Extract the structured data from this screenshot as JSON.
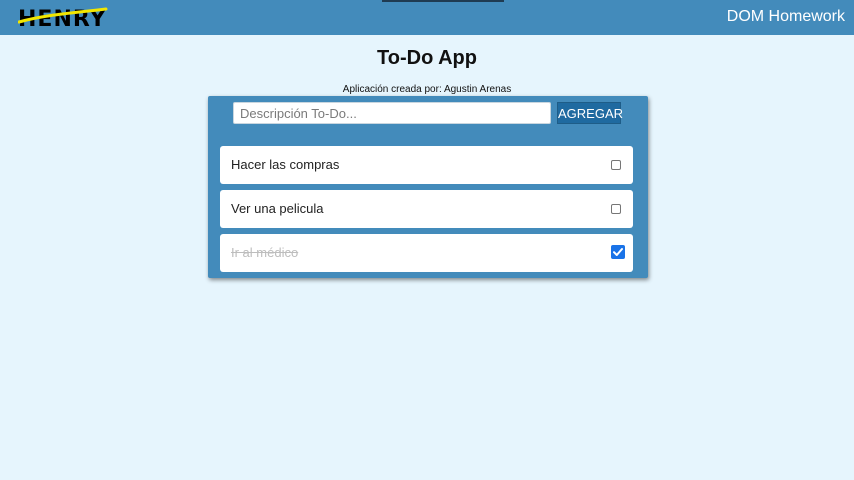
{
  "navbar": {
    "logo_text": "HENRY",
    "title": "DOM Homework"
  },
  "page": {
    "title": "To-Do App",
    "subtitle": "Aplicación creada por: Agustin Arenas"
  },
  "form": {
    "placeholder": "Descripción To-Do...",
    "value": "",
    "add_label": "AGREGAR"
  },
  "todos": [
    {
      "text": "Hacer las compras",
      "completed": false
    },
    {
      "text": "Ver una pelicula",
      "completed": false
    },
    {
      "text": "Ir al médico",
      "completed": true
    }
  ],
  "icons": {
    "logo": "henry-logo-icon",
    "check": "checkmark-icon"
  },
  "colors": {
    "navbar": "#438bbb",
    "background": "#e6f5fd",
    "button": "#1f6aa0",
    "logo_stripe": "#f2e600",
    "checkbox_checked": "#1a73e8"
  }
}
